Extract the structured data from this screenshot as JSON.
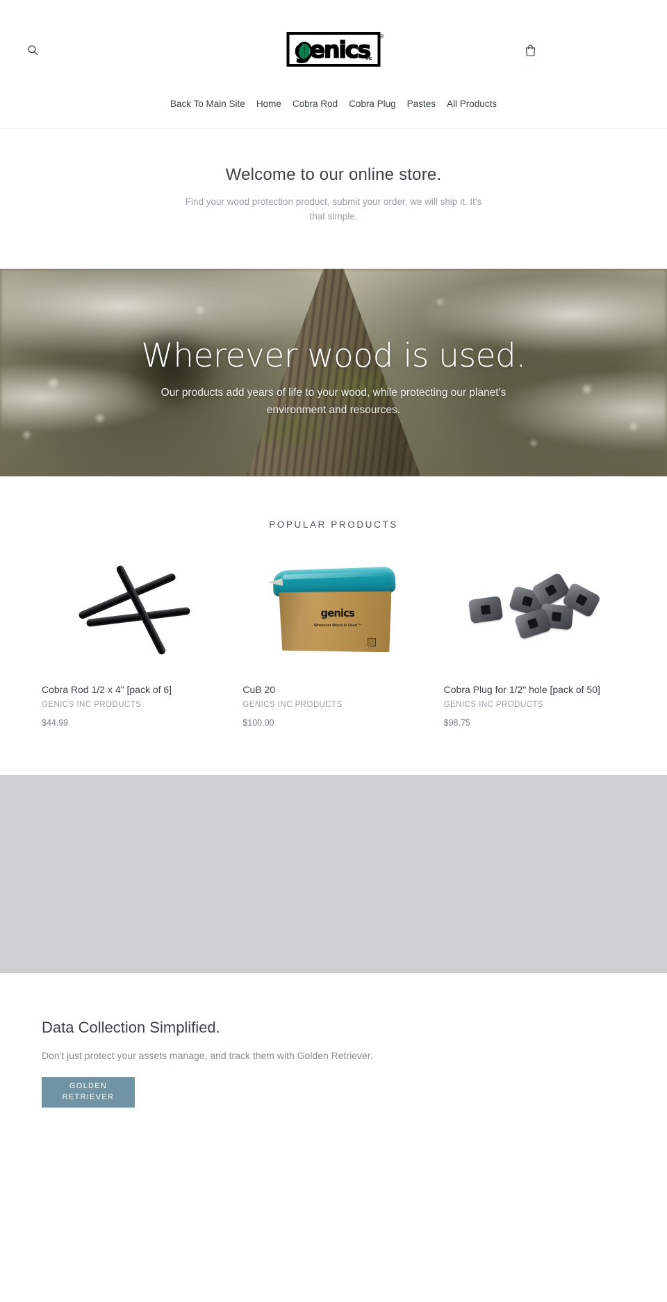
{
  "header": {
    "search_icon": "search-icon",
    "cart_icon": "shopping-bag-icon",
    "logo": {
      "wordmark": "genics",
      "suffix": "inc",
      "registered": "®",
      "leaf_color": "#0a7d50"
    }
  },
  "nav": {
    "items": [
      {
        "label": "Back To Main Site"
      },
      {
        "label": "Home"
      },
      {
        "label": "Cobra Rod"
      },
      {
        "label": "Cobra Plug"
      },
      {
        "label": "Pastes"
      },
      {
        "label": "All Products"
      }
    ]
  },
  "welcome": {
    "heading": "Welcome to our online store.",
    "subheading": "Find your wood protection product, submit your order, we will ship it. It's that simple."
  },
  "hero": {
    "title": "Wherever wood is used.",
    "subtitle": "Our products add years of life to your wood, while protecting our planet's environment and resources."
  },
  "products": {
    "section_title": "POPULAR PRODUCTS",
    "items": [
      {
        "title": "Cobra Rod 1/2 x 4\" [pack of 6]",
        "vendor": "GENICS INC PRODUCTS",
        "price": "$44.99",
        "image": "cobra-rod-image"
      },
      {
        "title": "CuB 20",
        "vendor": "GENICS INC PRODUCTS",
        "price": "$100.00",
        "image": "cub-20-box-image",
        "box_logo": "genics",
        "box_tagline": "Wherever Wood Is Used™"
      },
      {
        "title": "Cobra Plug for 1/2\" hole [pack of 50]",
        "vendor": "GENICS INC PRODUCTS",
        "price": "$98.75",
        "image": "cobra-plug-image"
      }
    ]
  },
  "data_section": {
    "title": "Data Collection Simplified.",
    "subtitle": "Don't just protect your assets manage, and track them with Golden Retriever.",
    "button_line1": "GOLDEN",
    "button_line2": "RETRIEVER",
    "button_color": "#7194a4"
  }
}
